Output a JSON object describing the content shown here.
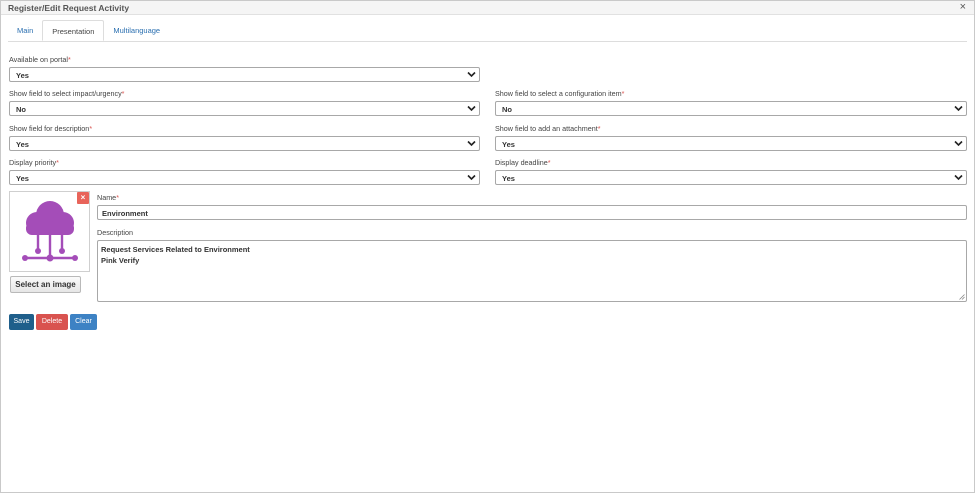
{
  "window": {
    "title": "Register/Edit Request Activity",
    "close": "×"
  },
  "tabs": [
    {
      "label": "Main"
    },
    {
      "label": "Presentation"
    },
    {
      "label": "Multilanguage"
    }
  ],
  "required_mark": "*",
  "fields": {
    "available_on_portal": {
      "label": "Available on portal",
      "value": "Yes"
    },
    "impact_urgency": {
      "label": "Show field to select impact/urgency",
      "value": "No"
    },
    "config_item": {
      "label": "Show field to select a configuration item",
      "value": "No"
    },
    "description_field": {
      "label": "Show field for description",
      "value": "Yes"
    },
    "attachment": {
      "label": "Show field to add an attachment",
      "value": "Yes"
    },
    "priority": {
      "label": "Display priority",
      "value": "Yes"
    },
    "deadline": {
      "label": "Display deadline",
      "value": "Yes"
    },
    "name": {
      "label": "Name",
      "value": "Environment"
    },
    "description": {
      "label": "Description",
      "lines": [
        "Request Services Related to Environment",
        "Pink Verify"
      ]
    }
  },
  "image": {
    "icon": "cloud-network-icon",
    "color": "#a44db8",
    "remove_label": "×",
    "select_label": "Select an image"
  },
  "buttons": {
    "save": "Save",
    "delete": "Delete",
    "clear": "Clear"
  },
  "colors": {
    "save": "#1f5f8b",
    "delete": "#d9534f",
    "clear": "#3d82c4",
    "required": "#d9534f",
    "tab_link": "#2a6fb0"
  }
}
